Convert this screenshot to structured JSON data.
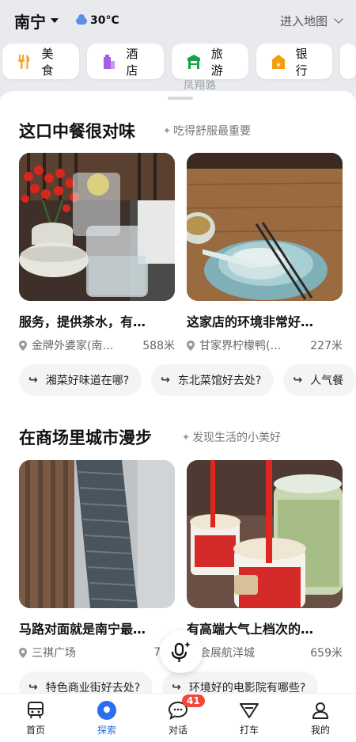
{
  "header": {
    "city": "南宁",
    "temperature": "30°C",
    "map_entry": "进入地图"
  },
  "map": {
    "road_label": "凤翔路"
  },
  "categories": [
    {
      "label": "美食",
      "icon": "fork-knife-icon",
      "color": "#f5a623"
    },
    {
      "label": "酒店",
      "icon": "hotel-icon",
      "color": "#a45ee5"
    },
    {
      "label": "旅游",
      "icon": "gate-icon",
      "color": "#16a34a"
    },
    {
      "label": "银行",
      "icon": "bank-icon",
      "color": "#f59e0b"
    }
  ],
  "section1": {
    "title": "这口中餐很对味",
    "subtitle": "吃得舒服最重要",
    "cards": [
      {
        "title": "服务，提供茶水，有…",
        "place": "金牌外婆家(南…",
        "distance": "588米"
      },
      {
        "title": "这家店的环境非常好…",
        "place": "甘家界柠檬鸭(…",
        "distance": "227米"
      }
    ],
    "queries": [
      "湘菜好味道在哪?",
      "东北菜馆好去处?",
      "人气餐"
    ]
  },
  "section2": {
    "title": "在商场里城市漫步",
    "subtitle": "发现生活的小美好",
    "cards": [
      {
        "title": "马路对面就是南宁最…",
        "place": "三祺广场",
        "distance": "782"
      },
      {
        "title": "有高端大气上档次的…",
        "place": "会展航洋城",
        "distance": "659米"
      }
    ],
    "queries": [
      "特色商业街好去处?",
      "环境好的电影院有哪些?"
    ]
  },
  "nav": {
    "items": [
      {
        "label": "首页",
        "icon": "home-bus-icon"
      },
      {
        "label": "探索",
        "icon": "explore-pin-icon"
      },
      {
        "label": "对话",
        "icon": "chat-icon",
        "badge": "41"
      },
      {
        "label": "打车",
        "icon": "taxi-icon"
      },
      {
        "label": "我的",
        "icon": "profile-icon"
      }
    ],
    "active_color": "#2a6ff0"
  }
}
